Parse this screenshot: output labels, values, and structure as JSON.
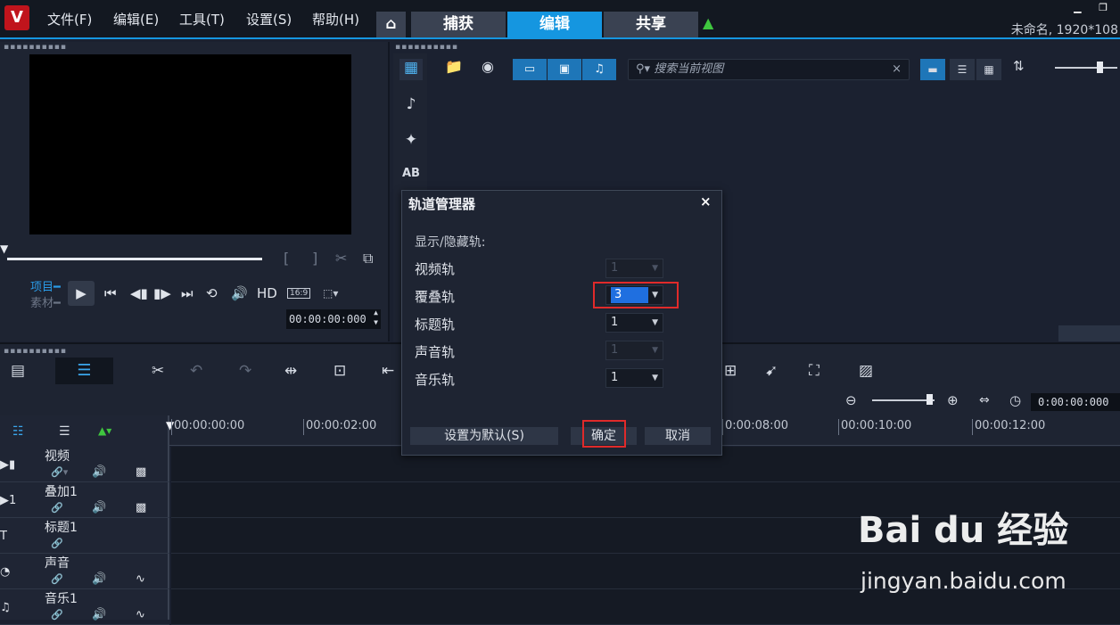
{
  "app": {
    "logo_letter": "V",
    "project_title": "未命名, 1920*108",
    "window_controls": "▁ ❐"
  },
  "menu": [
    "文件(F)",
    "编辑(E)",
    "工具(T)",
    "设置(S)",
    "帮助(H)"
  ],
  "tabs": {
    "home": "⌂",
    "capture": "捕获",
    "edit": "编辑",
    "share": "共享"
  },
  "preview": {
    "mode_project": "项目",
    "mode_clip": "素材",
    "hd_label": "HD",
    "ratio": "16:9",
    "timecode": "00:00:00:000"
  },
  "library": {
    "search_placeholder": "搜索当前视图"
  },
  "timeline": {
    "timecode": "0:00:00:000",
    "ruler": [
      "00:00:00:00",
      "00:00:02:00",
      "0:00:08:00",
      "00:00:10:00",
      "00:00:12:00"
    ],
    "tracks": [
      {
        "name": "视频"
      },
      {
        "name": "叠加1"
      },
      {
        "name": "标题1"
      },
      {
        "name": "声音"
      },
      {
        "name": "音乐1"
      }
    ]
  },
  "dialog": {
    "title": "轨道管理器",
    "close": "×",
    "section": "显示/隐藏轨:",
    "rows": [
      {
        "label": "视频轨",
        "value": "1",
        "disabled": true
      },
      {
        "label": "覆叠轨",
        "value": "3",
        "disabled": false,
        "selected": true
      },
      {
        "label": "标题轨",
        "value": "1",
        "disabled": false
      },
      {
        "label": "声音轨",
        "value": "1",
        "disabled": true
      },
      {
        "label": "音乐轨",
        "value": "1",
        "disabled": false
      }
    ],
    "default_button": "设置为默认(S)",
    "ok_button": "确定",
    "cancel_button": "取消"
  },
  "watermark": {
    "brand": "Bai du 经验",
    "url": "jingyan.baidu.com"
  },
  "colors": {
    "accent": "#1596e0",
    "highlight": "#e02a2a"
  }
}
